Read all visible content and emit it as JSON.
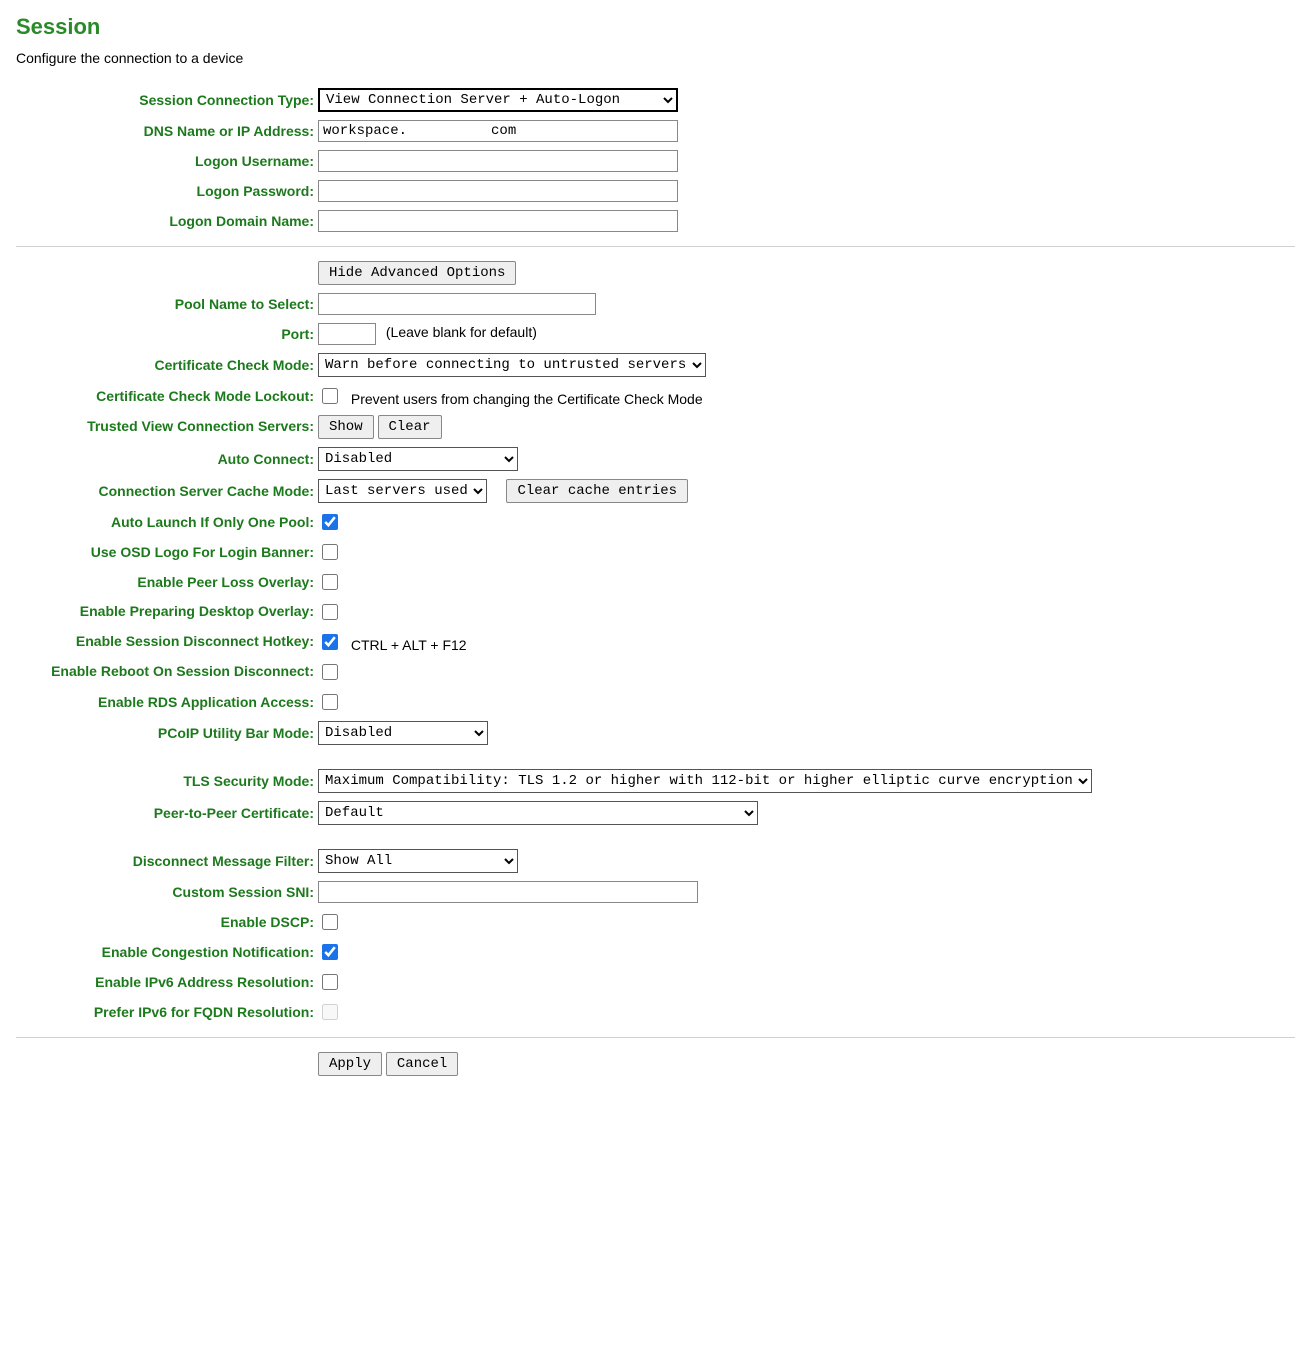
{
  "header": {
    "title": "Session",
    "subtitle": "Configure the connection to a device"
  },
  "labels": {
    "conn_type": "Session Connection Type:",
    "dns": "DNS Name or IP Address:",
    "username": "Logon Username:",
    "password": "Logon Password:",
    "domain": "Logon Domain Name:",
    "hide_adv": "Hide Advanced Options",
    "pool": "Pool Name to Select:",
    "port": "Port:",
    "port_hint": "(Leave blank for default)",
    "cert_mode": "Certificate Check Mode:",
    "cert_lockout": "Certificate Check Mode Lockout:",
    "cert_lockout_text": "Prevent users from changing the Certificate Check Mode",
    "trusted_servers": "Trusted View Connection Servers:",
    "show": "Show",
    "clear": "Clear",
    "auto_connect": "Auto Connect:",
    "cache_mode": "Connection Server Cache Mode:",
    "clear_cache": "Clear cache entries",
    "auto_launch": "Auto Launch If Only One Pool:",
    "osd_logo": "Use OSD Logo For Login Banner:",
    "peer_loss": "Enable Peer Loss Overlay:",
    "preparing": "Enable Preparing Desktop Overlay:",
    "hotkey": "Enable Session Disconnect Hotkey:",
    "hotkey_text": "CTRL + ALT + F12",
    "reboot": "Enable Reboot On Session Disconnect:",
    "rds": "Enable RDS Application Access:",
    "pcoip_bar": "PCoIP Utility Bar Mode:",
    "tls_mode": "TLS Security Mode:",
    "p2p_cert": "Peer-to-Peer Certificate:",
    "disconnect_filter": "Disconnect Message Filter:",
    "sni": "Custom Session SNI:",
    "dscp": "Enable DSCP:",
    "congestion": "Enable Congestion Notification:",
    "ipv6_res": "Enable IPv6 Address Resolution:",
    "ipv6_pref": "Prefer IPv6 for FQDN Resolution:",
    "apply": "Apply",
    "cancel": "Cancel"
  },
  "values": {
    "conn_type": "View Connection Server + Auto-Logon",
    "dns": "workspace.          com",
    "username": "",
    "password": "",
    "domain": "",
    "pool": "",
    "port": "",
    "cert_mode": "Warn before connecting to untrusted servers",
    "cert_lockout": false,
    "auto_connect": "Disabled",
    "cache_mode": "Last servers used",
    "auto_launch": true,
    "osd_logo": false,
    "peer_loss": false,
    "preparing": false,
    "hotkey": true,
    "reboot": false,
    "rds": false,
    "pcoip_bar": "Disabled",
    "tls_mode": "Maximum Compatibility: TLS 1.2 or higher with 112-bit or higher elliptic curve encryption",
    "p2p_cert": "Default",
    "disconnect_filter": "Show All",
    "sni": "",
    "dscp": false,
    "congestion": true,
    "ipv6_res": false,
    "ipv6_pref": false
  }
}
